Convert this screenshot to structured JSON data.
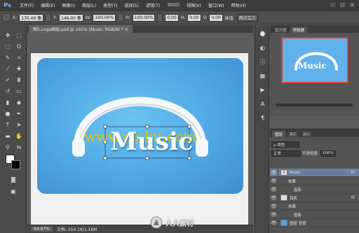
{
  "app": {
    "logo": "Ps",
    "menus": [
      "文件(F)",
      "编辑(E)",
      "图像(I)",
      "图层(L)",
      "类型(Y)",
      "选择(S)",
      "滤镜(T)",
      "3D(D)",
      "视图(V)",
      "窗口(W)",
      "帮助(H)"
    ],
    "window_controls": [
      "–",
      "□",
      "✕"
    ]
  },
  "options_bar": {
    "x_label": "X:",
    "x_value": "170.49 像",
    "y_label": "Y:",
    "y_value": "146.00 像",
    "w_label": "W:",
    "w_value": "100.00%",
    "h_label": "H:",
    "h_value": "100.00%",
    "angle_value": "0.00",
    "h2_label": "H:",
    "h2_value": "0.00",
    "v_label": "V:",
    "v_value": "0.00",
    "interp_label": "插值:",
    "interp_value": "两次立方"
  },
  "document": {
    "tab_title": "图5.Logo图层.psd @ 165% (Music, RGB/8) * ✕",
    "watermark_text": "www.cg-ku.com",
    "music_text": "Music",
    "nav_music_text": "Music"
  },
  "status": {
    "zoom": "64.97%",
    "doc_info": "文档: 254.1K/1.16M"
  },
  "navigator": {
    "tabs": [
      "直方图",
      "导航器"
    ],
    "active_tab": "导航器"
  },
  "layers": {
    "tabs": [
      "图层",
      "通道",
      "路径"
    ],
    "kind_filter": "ρ 类型",
    "blend_mode": "正常",
    "opacity_label": "不透明度:",
    "opacity_value": "100%",
    "lock_label": "锁定:",
    "fill_label": "填充:",
    "fill_value": "100%",
    "rows": [
      {
        "name": "Music",
        "thumb": "T",
        "fx": "fx",
        "selected": true
      },
      {
        "name": "效果",
        "thumb": "",
        "fx": "",
        "selected": false
      },
      {
        "name": "投影",
        "thumb": "",
        "fx": "",
        "selected": false
      },
      {
        "name": "耳机",
        "thumb": " ",
        "fx": "fx",
        "selected": false
      },
      {
        "name": "效果",
        "thumb": "",
        "fx": "",
        "selected": false
      },
      {
        "name": "投影",
        "thumb": "",
        "fx": "",
        "selected": false
      },
      {
        "name": "图层 背景",
        "thumb": " ",
        "fx": "",
        "selected": false
      }
    ]
  },
  "brand_watermark": "人人素材",
  "colors": {
    "accent_blue": "#4fa7e3",
    "watermark_yellow": "#e8c400",
    "nav_frame_red": "#e03c3c"
  }
}
